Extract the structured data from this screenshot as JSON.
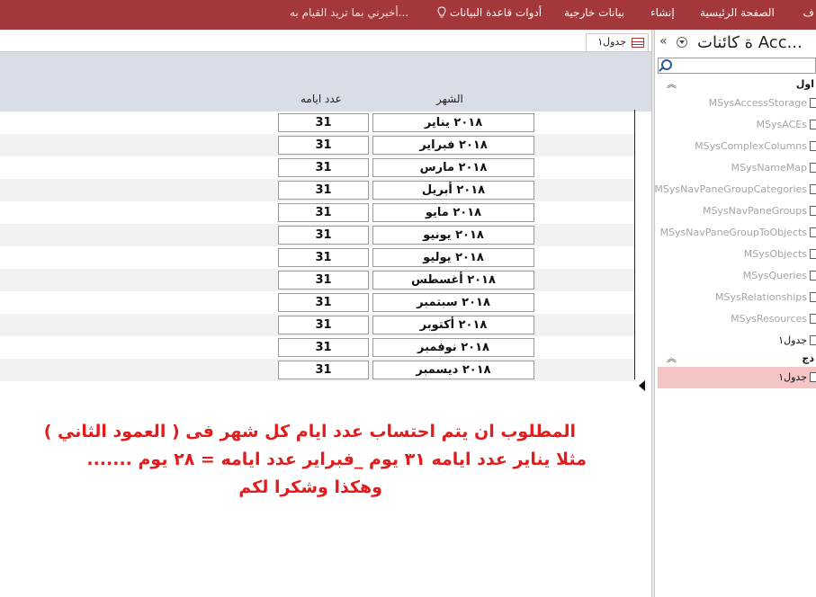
{
  "ribbon": {
    "tabs": [
      "ف",
      "الصفحة الرئيسية",
      "إنشاء",
      "بيانات خارجية",
      "أدوات قاعدة البيانات"
    ],
    "tell_me": "أخبرني بما تريد القيام به...",
    "tell_me_icon": "lightbulb-icon"
  },
  "document_tab": {
    "label": "جدول١",
    "icon": "table-icon"
  },
  "form": {
    "column_month": "الشهر",
    "column_days": "عدد ايامه",
    "rows": [
      {
        "month": "٢٠١٨ يناير",
        "days": "31"
      },
      {
        "month": "٢٠١٨ فبراير",
        "days": "31"
      },
      {
        "month": "٢٠١٨ مارس",
        "days": "31"
      },
      {
        "month": "٢٠١٨ أبريل",
        "days": "31"
      },
      {
        "month": "٢٠١٨ مايو",
        "days": "31"
      },
      {
        "month": "٢٠١٨ يونيو",
        "days": "31"
      },
      {
        "month": "٢٠١٨ يوليو",
        "days": "31"
      },
      {
        "month": "٢٠١٨ أغسطس",
        "days": "31"
      },
      {
        "month": "٢٠١٨ سبتمبر",
        "days": "31"
      },
      {
        "month": "٢٠١٨ أكتوبر",
        "days": "31"
      },
      {
        "month": "٢٠١٨ نوفمبر",
        "days": "31"
      },
      {
        "month": "٢٠١٨ ديسمبر",
        "days": "31"
      }
    ],
    "note": [
      "المطلوب ان يتم احتساب عدد ايام كل شهر فى ( العمود الثاني )",
      "مثلا يناير عدد ايامه ٣١ يوم _فبراير عدد ايامه = ٢٨ يوم .......",
      "وهكذا وشكرا لكم"
    ]
  },
  "nav_pane": {
    "title": "ة كائنات Acc...",
    "collapse_icon": "double-chevron-icon",
    "menu_icon": "dropdown-circle-icon",
    "search_icon": "search-icon",
    "search_placeholder": "",
    "groups": [
      {
        "label": "اول",
        "items": [
          {
            "label": "MSysAccessStorage",
            "system": true
          },
          {
            "label": "MSysACEs",
            "system": true
          },
          {
            "label": "MSysComplexColumns",
            "system": true
          },
          {
            "label": "MSysNameMap",
            "system": true
          },
          {
            "label": "MSysNavPaneGroupCategories",
            "system": true
          },
          {
            "label": "MSysNavPaneGroups",
            "system": true
          },
          {
            "label": "MSysNavPaneGroupToObjects",
            "system": true
          },
          {
            "label": "MSysObjects",
            "system": true
          },
          {
            "label": "MSysQueries",
            "system": true
          },
          {
            "label": "MSysRelationships",
            "system": true
          },
          {
            "label": "MSysResources",
            "system": true
          },
          {
            "label": "جدول١",
            "system": false
          }
        ]
      },
      {
        "label": "ذج",
        "items": [
          {
            "label": "جدول١",
            "system": false,
            "selected": true
          }
        ]
      }
    ]
  },
  "colors": {
    "ribbon": "#a4373a",
    "note_text": "#e11c1c",
    "selected_item": "#f5c4c4",
    "form_header": "#d9dde5"
  }
}
